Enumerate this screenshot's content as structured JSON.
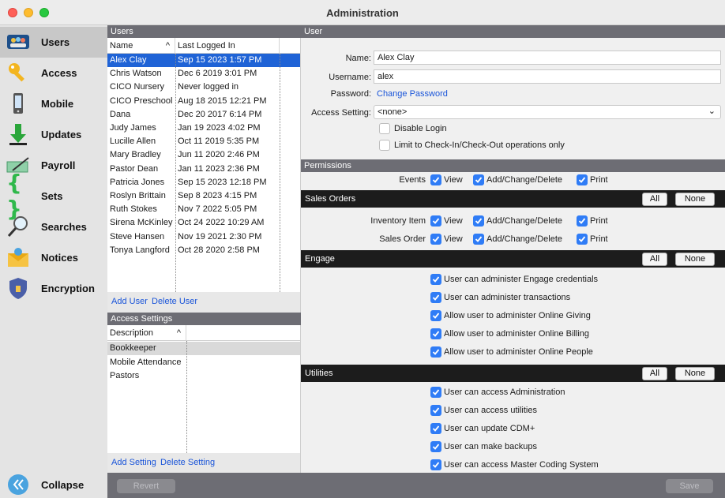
{
  "window": {
    "title": "Administration"
  },
  "sidebar": {
    "items": [
      {
        "label": "Users",
        "icon": "users-icon"
      },
      {
        "label": "Access",
        "icon": "key-icon"
      },
      {
        "label": "Mobile",
        "icon": "mobile-icon"
      },
      {
        "label": "Updates",
        "icon": "download-arrow-icon"
      },
      {
        "label": "Payroll",
        "icon": "check-pen-icon"
      },
      {
        "label": "Sets",
        "icon": "braces-icon"
      },
      {
        "label": "Searches",
        "icon": "magnifier-icon"
      },
      {
        "label": "Notices",
        "icon": "envelope-icon"
      },
      {
        "label": "Encryption",
        "icon": "shield-icon"
      }
    ],
    "collapse_label": "Collapse"
  },
  "users": {
    "header": "Users",
    "col_name": "Name",
    "col_sort": "^",
    "col_last": "Last Logged In",
    "rows": [
      {
        "name": "Alex Clay",
        "last": "Sep 15 2023 1:57 PM"
      },
      {
        "name": "Chris Watson",
        "last": "Dec 6 2019 3:01 PM"
      },
      {
        "name": "CICO Nursery",
        "last": "Never logged in"
      },
      {
        "name": "CICO Preschool",
        "last": "Aug 18 2015 12:21 PM"
      },
      {
        "name": "Dana",
        "last": "Dec 20 2017 6:14 PM"
      },
      {
        "name": "Judy James",
        "last": "Jan 19 2023 4:02 PM"
      },
      {
        "name": "Lucille Allen",
        "last": "Oct 11 2019 5:35 PM"
      },
      {
        "name": "Mary Bradley",
        "last": "Jun 11 2020 2:46 PM"
      },
      {
        "name": "Pastor Dean",
        "last": "Jan 11 2023 2:36 PM"
      },
      {
        "name": "Patricia Jones",
        "last": "Sep 15 2023 12:18 PM"
      },
      {
        "name": "Roslyn Brittain",
        "last": "Sep 8 2023 4:15 PM"
      },
      {
        "name": "Ruth Stokes",
        "last": "Nov 7 2022 5:05 PM"
      },
      {
        "name": "Sirena McKinley",
        "last": "Oct 24 2022 10:29 AM"
      },
      {
        "name": "Steve Hansen",
        "last": "Nov 19 2021 2:30 PM"
      },
      {
        "name": "Tonya Langford",
        "last": "Oct 28 2020 2:58 PM"
      }
    ],
    "add_label": "Add User",
    "delete_label": "Delete User"
  },
  "access_settings": {
    "header": "Access Settings",
    "col_desc": "Description",
    "col_sort": "^",
    "rows": [
      "Bookkeeper",
      "Mobile Attendance",
      "Pastors"
    ],
    "add_label": "Add Setting",
    "delete_label": "Delete Setting"
  },
  "user_form": {
    "header": "User",
    "name_label": "Name:",
    "name_value": "Alex Clay",
    "username_label": "Username:",
    "username_value": "alex",
    "password_label": "Password:",
    "change_password": "Change Password",
    "access_label": "Access Setting:",
    "access_value": "<none>",
    "disable_login": "Disable Login",
    "limit_checkin": "Limit to Check-In/Check-Out operations only"
  },
  "permissions": {
    "header": "Permissions",
    "view": "View",
    "add": "Add/Change/Delete",
    "print": "Print",
    "all": "All",
    "none": "None",
    "events": "Events",
    "sales_header": "Sales Orders",
    "inventory": "Inventory Item",
    "sales_order": "Sales Order",
    "engage_header": "Engage",
    "engage_items": [
      "User can administer Engage credentials",
      "User can administer transactions",
      "Allow user to administer Online Giving",
      "Allow user to administer Online Billing",
      "Allow user to administer Online People"
    ],
    "utilities_header": "Utilities",
    "utilities_items": [
      "User can access Administration",
      "User can access utilities",
      "User can update CDM+",
      "User can make backups",
      "User can access Master Coding System"
    ]
  },
  "bottom": {
    "revert": "Revert",
    "save": "Save"
  },
  "colors": {
    "accent": "#1f63d6",
    "header_gray": "#6d6d74",
    "section_black": "#1c1c1c",
    "checkbox": "#2f7cf6"
  }
}
